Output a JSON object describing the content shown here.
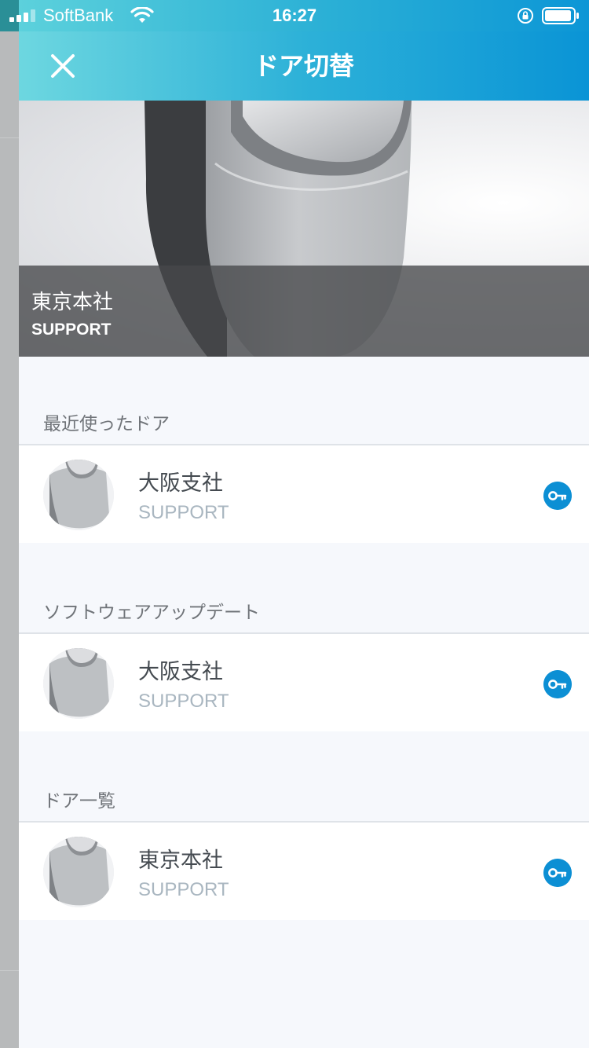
{
  "status_bar": {
    "carrier": "SoftBank",
    "time": "16:27"
  },
  "nav": {
    "title": "ドア切替"
  },
  "current_door": {
    "name": "東京本社",
    "group": "SUPPORT"
  },
  "sections": [
    {
      "label": "最近使ったドア",
      "items": [
        {
          "name": "大阪支社",
          "group": "SUPPORT"
        }
      ]
    },
    {
      "label": "ソフトウェアアップデート",
      "items": [
        {
          "name": "大阪支社",
          "group": "SUPPORT"
        }
      ]
    },
    {
      "label": "ドア一覧",
      "items": [
        {
          "name": "東京本社",
          "group": "SUPPORT"
        }
      ]
    }
  ],
  "colors": {
    "accent": "#0c8fd4",
    "header_start": "#6dd7e0",
    "header_end": "#0a94d6"
  },
  "icons": {
    "close": "close-icon",
    "key": "key-icon"
  }
}
